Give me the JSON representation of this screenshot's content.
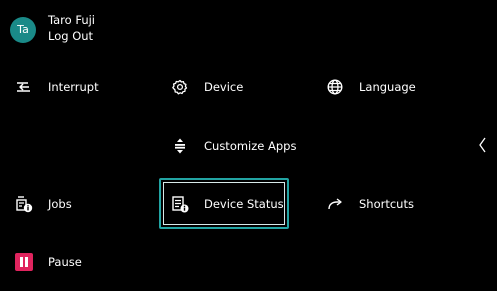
{
  "user": {
    "initials": "Ta",
    "name": "Taro Fuji",
    "logout_label": "Log Out"
  },
  "tiles": {
    "interrupt": {
      "label": "Interrupt",
      "icon": "interrupt-icon"
    },
    "device": {
      "label": "Device",
      "icon": "gear-icon"
    },
    "language": {
      "label": "Language",
      "icon": "globe-icon"
    },
    "customize_apps": {
      "label": "Customize Apps",
      "icon": "up-down-arrows-icon"
    },
    "jobs": {
      "label": "Jobs",
      "icon": "jobs-info-icon"
    },
    "device_status": {
      "label": "Device Status",
      "icon": "device-status-icon",
      "selected": true
    },
    "shortcuts": {
      "label": "Shortcuts",
      "icon": "share-arrow-icon"
    },
    "pause": {
      "label": "Pause",
      "icon": "pause-icon"
    }
  },
  "colors": {
    "background": "#000000",
    "avatar": "#1a8a88",
    "selection": "#22a4a3",
    "pause": "#e0245e"
  }
}
